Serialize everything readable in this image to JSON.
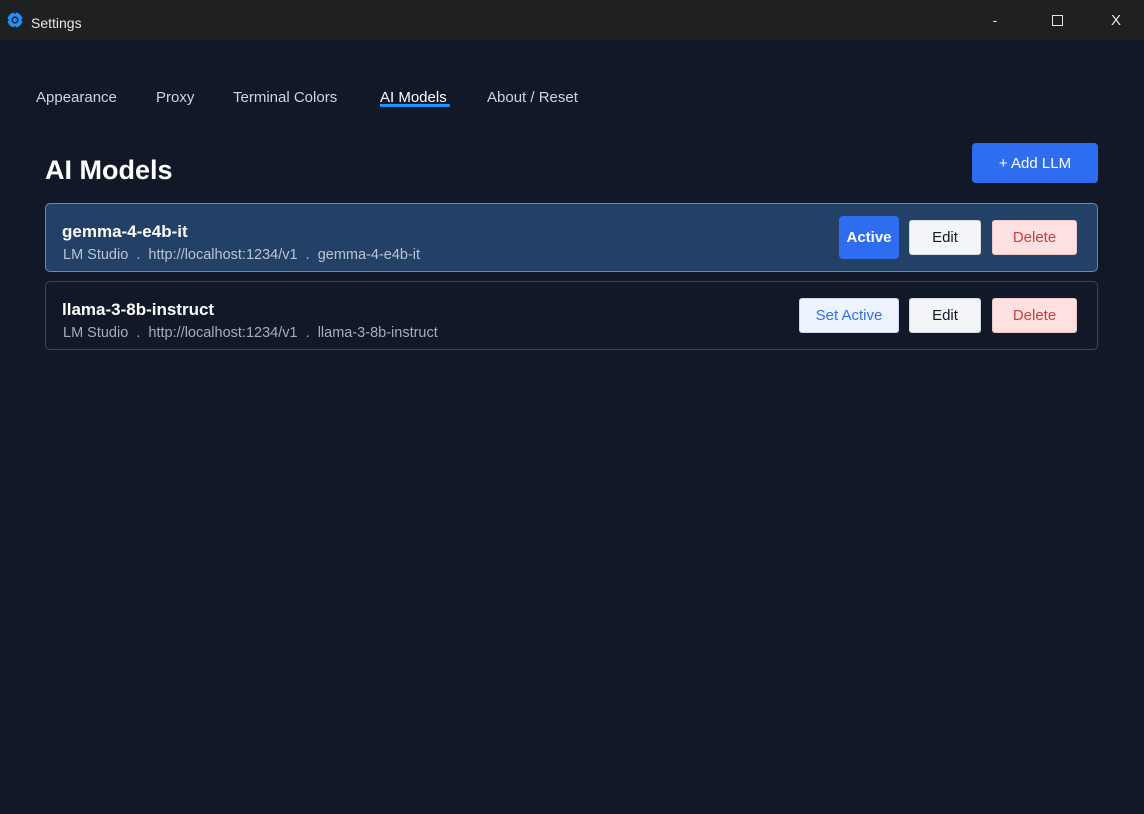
{
  "window": {
    "title": "Settings",
    "minimize_label": "-",
    "close_label": "X",
    "accent_color": "#1e90ff"
  },
  "tabs": [
    {
      "label": "Appearance",
      "active": false
    },
    {
      "label": "Proxy",
      "active": false
    },
    {
      "label": "Terminal Colors",
      "active": false
    },
    {
      "label": "AI Models",
      "active": true
    },
    {
      "label": "About / Reset",
      "active": false
    }
  ],
  "main": {
    "title": "AI Models",
    "add_button_label": "+ Add LLM"
  },
  "models": [
    {
      "name": "gemma-4-e4b-it",
      "meta": "LM Studio  .  http://localhost:1234/v1  .  gemma-4-e4b-it",
      "is_active": true,
      "status_label": "Active",
      "edit_label": "Edit",
      "delete_label": "Delete"
    },
    {
      "name": "llama-3-8b-instruct",
      "meta": "LM Studio  .  http://localhost:1234/v1  .  llama-3-8b-instruct",
      "is_active": false,
      "status_label": "Set Active",
      "edit_label": "Edit",
      "delete_label": "Delete"
    }
  ],
  "colors": {
    "background": "#111827",
    "titlebar": "#1e2021",
    "primary": "#2f6df0",
    "active_card": "#234066",
    "delete_text": "#d33a3a",
    "delete_bg": "#ffe1e1"
  }
}
